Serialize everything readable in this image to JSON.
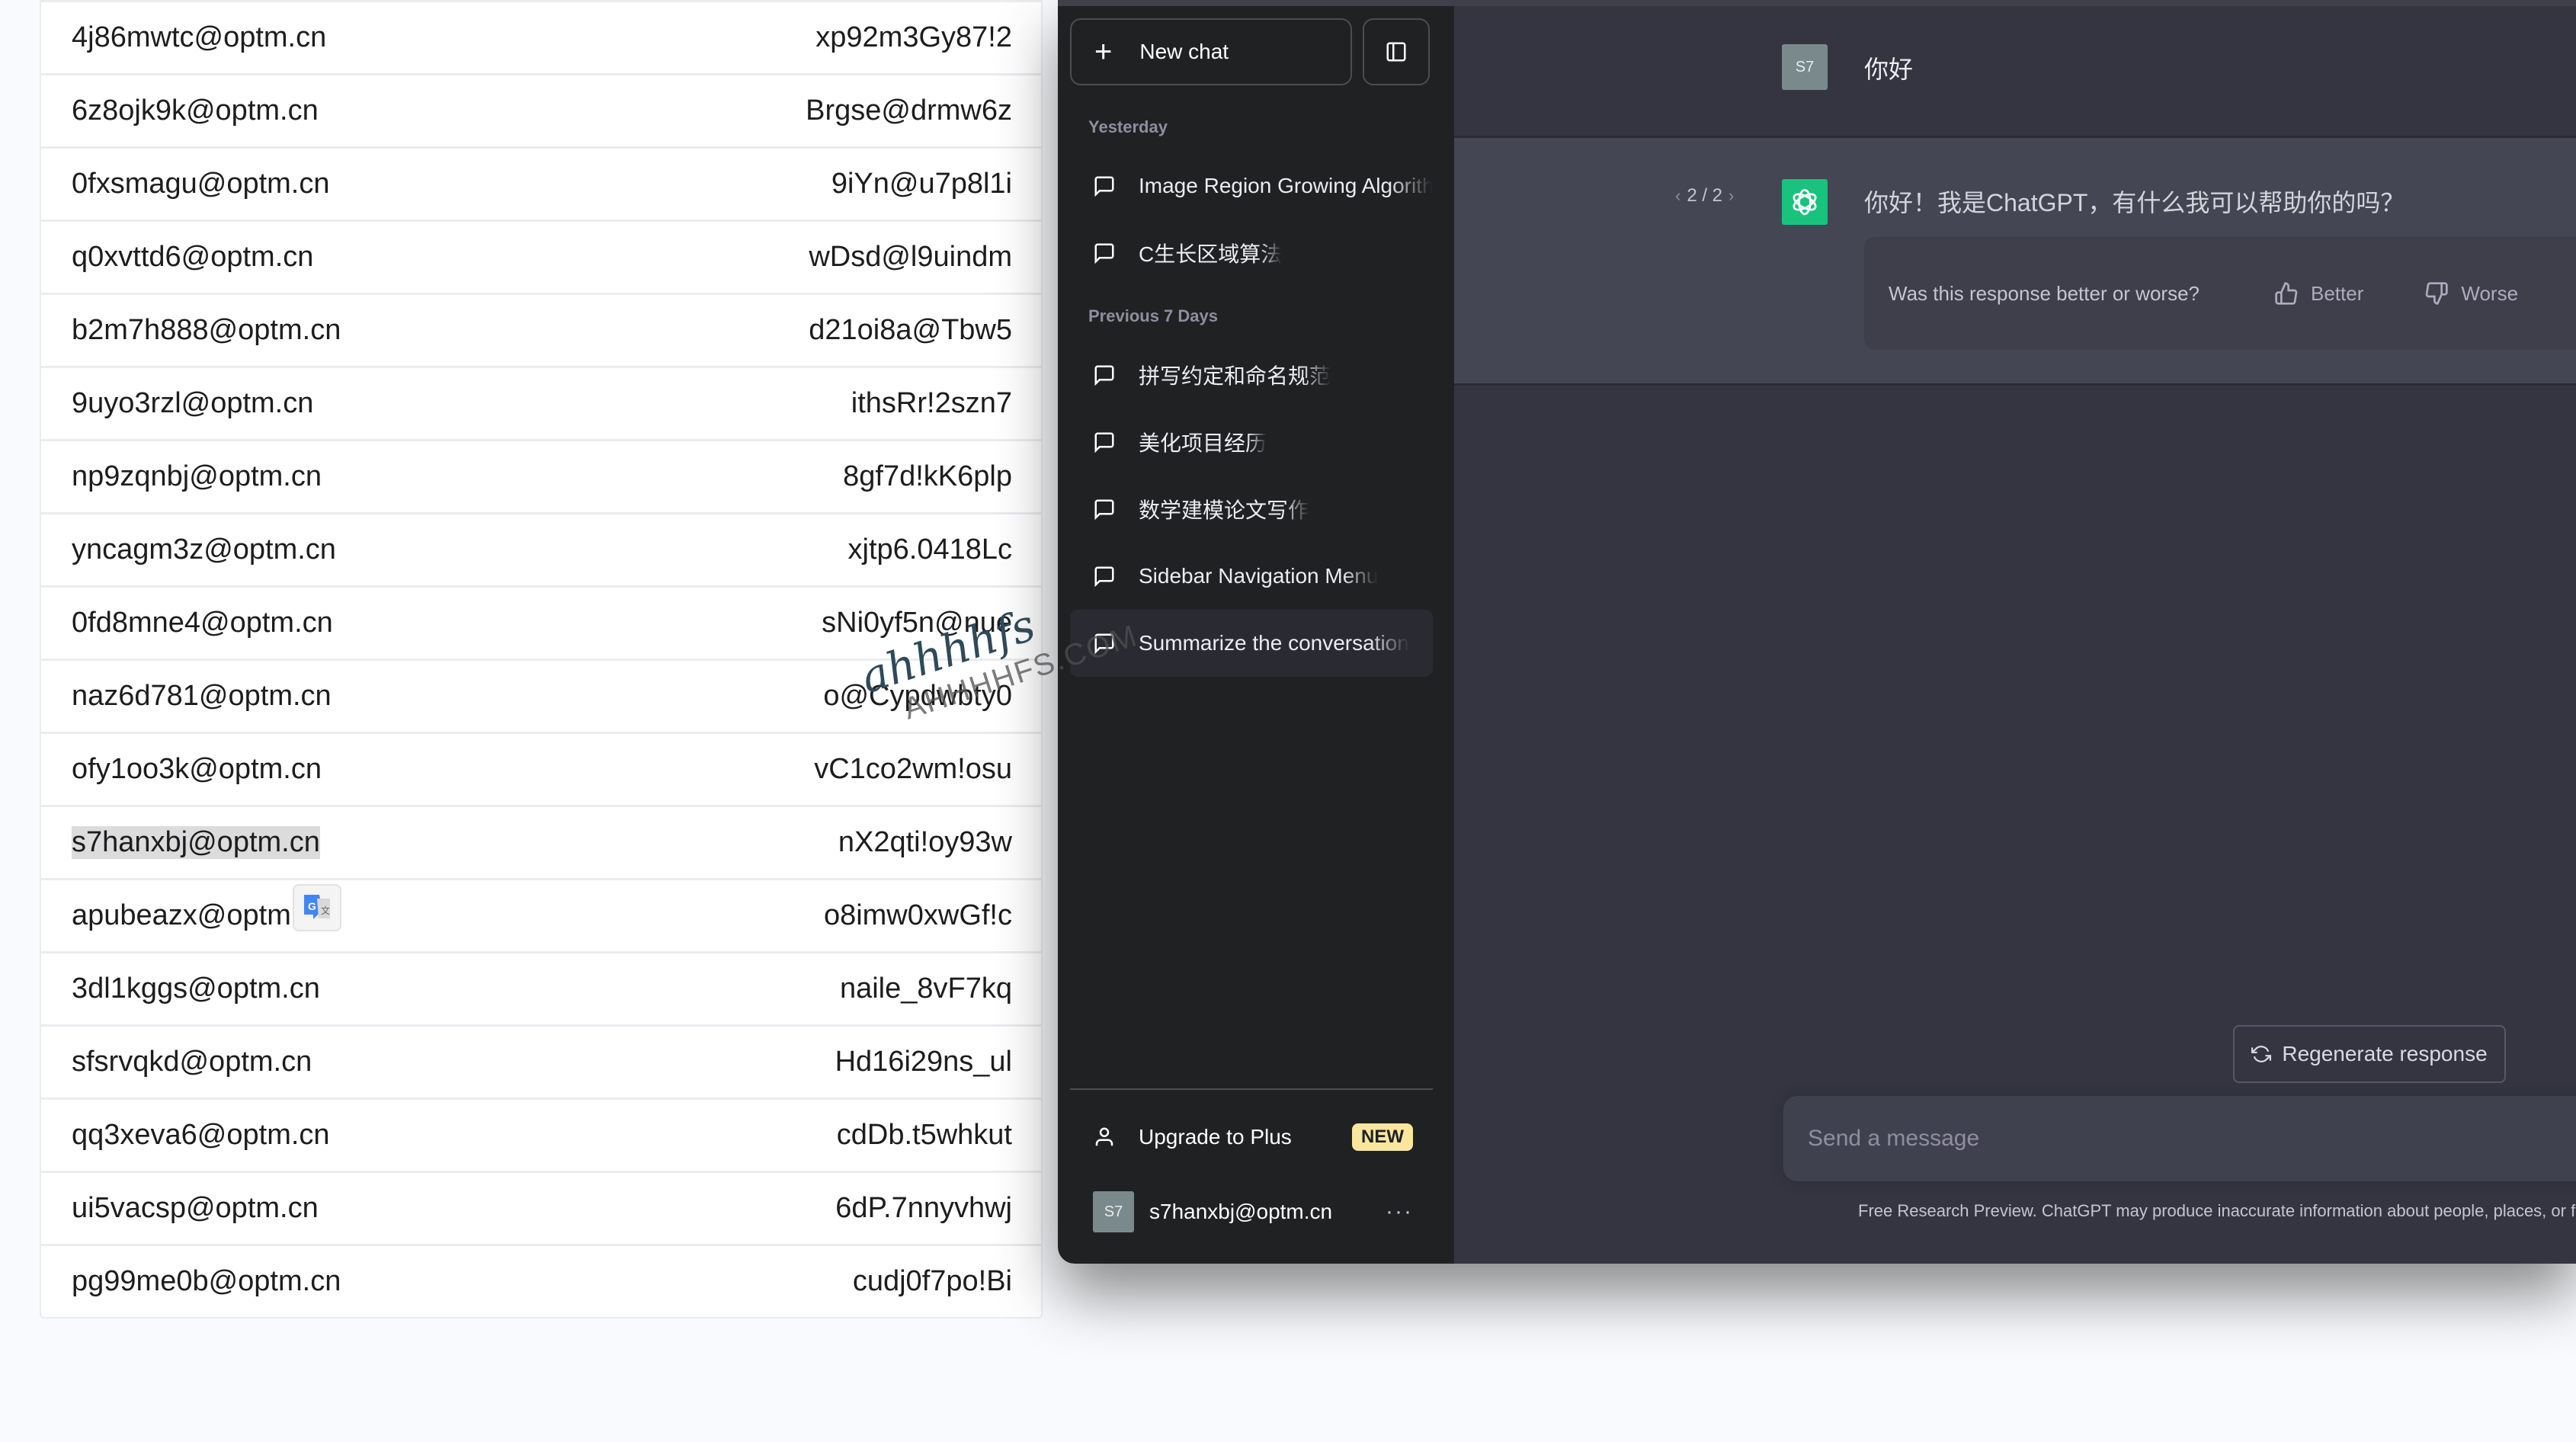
{
  "credentials": {
    "rows": [
      {
        "email": "4j86mwtc@optm.cn",
        "password": "xp92m3Gy87!2"
      },
      {
        "email": "6z8ojk9k@optm.cn",
        "password": "Brgse@drmw6z"
      },
      {
        "email": "0fxsmagu@optm.cn",
        "password": "9iYn@u7p8l1i"
      },
      {
        "email": "q0xvttd6@optm.cn",
        "password": "wDsd@l9uindm"
      },
      {
        "email": "b2m7h888@optm.cn",
        "password": "d21oi8a@Tbw5"
      },
      {
        "email": "9uyo3rzl@optm.cn",
        "password": "ithsRr!2szn7"
      },
      {
        "email": "np9zqnbj@optm.cn",
        "password": "8gf7d!kK6plp"
      },
      {
        "email": "yncagm3z@optm.cn",
        "password": "xjtp6.0418Lc"
      },
      {
        "email": "0fd8mne4@optm.cn",
        "password": "sNi0yf5n@nue"
      },
      {
        "email": "naz6d781@optm.cn",
        "password": "o@Cypdwbty0"
      },
      {
        "email": "ofy1oo3k@optm.cn",
        "password": "vC1co2wm!osu"
      },
      {
        "email": "s7hanxbj@optm.cn",
        "password": "nX2qti!oy93w",
        "selected": true
      },
      {
        "email": "apubeazx@optm.cn",
        "password": "o8imw0xwGf!c"
      },
      {
        "email": "3dl1kggs@optm.cn",
        "password": "naile_8vF7kq"
      },
      {
        "email": "sfsrvqkd@optm.cn",
        "password": "Hd16i29ns_ul"
      },
      {
        "email": "qq3xeva6@optm.cn",
        "password": "cdDb.t5whkut"
      },
      {
        "email": "ui5vacsp@optm.cn",
        "password": "6dP.7nnyvhwj"
      },
      {
        "email": "pg99me0b@optm.cn",
        "password": "cudj0f7po!Bi"
      }
    ],
    "translate_icon": "google-translate-icon"
  },
  "sidebar": {
    "new_chat_label": "New chat",
    "sections": [
      {
        "label": "Yesterday",
        "items": [
          "Image Region Growing Algorithm",
          "C生长区域算法"
        ]
      },
      {
        "label": "Previous 7 Days",
        "items": [
          "拼写约定和命名规范",
          "美化项目经历",
          "数学建模论文写作",
          "Sidebar Navigation Menu",
          "Summarize the conversation"
        ]
      }
    ],
    "active_item": "Summarize the conversation",
    "upgrade_label": "Upgrade to Plus",
    "upgrade_badge": "NEW",
    "account_email": "s7hanxbj@optm.cn",
    "avatar_initials": "S7",
    "more_label": "···"
  },
  "chat": {
    "user_avatar": "S7",
    "user_message": "你好",
    "pager": {
      "current": 2,
      "total": 2,
      "label": "2 / 2",
      "prev": "‹",
      "next": "›"
    },
    "assistant_message": "你好！我是ChatGPT，有什么我可以帮助你的吗？",
    "feedback_question": "Was this response better or worse?",
    "better_label": "Better",
    "worse_label": "Worse",
    "regenerate_label": "Regenerate response",
    "input_placeholder": "Send a message",
    "disclaimer": "Free Research Preview. ChatGPT may produce inaccurate information about people, places, or facts."
  },
  "colors": {
    "sidebar_bg": "#202123",
    "main_bg": "#343541",
    "assistant_bg": "#444654",
    "gpt_green": "#19c37d",
    "badge_yellow": "#fae69e"
  },
  "watermark": {
    "script": "ahhhhfs",
    "url": "AHHHHFS.COM"
  }
}
